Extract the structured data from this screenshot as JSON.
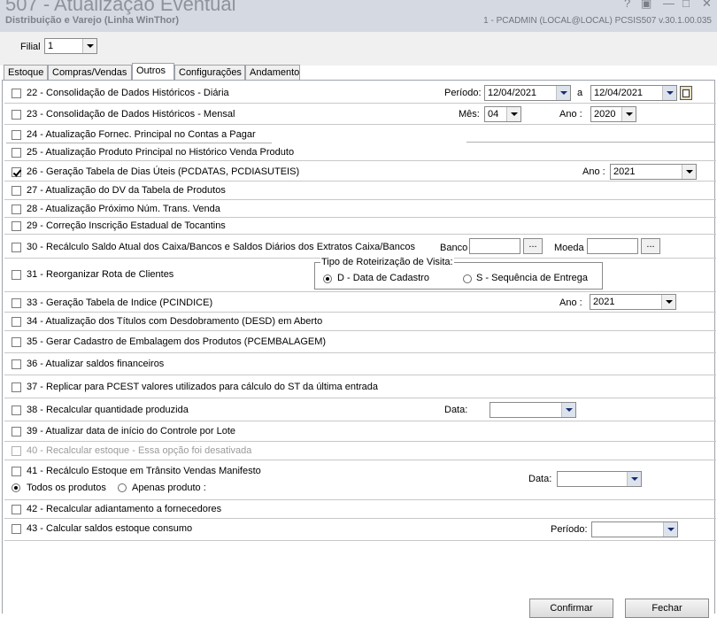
{
  "window": {
    "title": "507 - Atualização Eventual",
    "subtitle": "Distribuição e Varejo (Linha WinThor)",
    "info": "1 - PCADMIN (LOCAL@LOCAL)   PCSIS507  v.30.1.00.035",
    "controls": [
      "?",
      "▣",
      "—",
      "□",
      "✕"
    ]
  },
  "filial": {
    "label": "Filial",
    "value": "1"
  },
  "tabs": [
    {
      "label": "Estoque",
      "active": false
    },
    {
      "label": "Compras/Vendas",
      "active": false
    },
    {
      "label": "Outros",
      "active": true
    },
    {
      "label": "Configurações",
      "active": false
    },
    {
      "label": "Andamento",
      "active": false
    }
  ],
  "items": {
    "i22": {
      "label": "22 - Consolidação de Dados Históricos - Diária",
      "checked": false
    },
    "i23": {
      "label": "23 - Consolidação de Dados Históricos - Mensal",
      "checked": false
    },
    "i24": {
      "label": "24 - Atualização Fornec. Principal no Contas a Pagar",
      "checked": false
    },
    "i25": {
      "label": "25 - Atualização Produto Principal no Histórico Venda Produto",
      "checked": false
    },
    "i26": {
      "label": "26 - Geração Tabela de Dias Úteis (PCDATAS, PCDIASUTEIS)",
      "checked": true
    },
    "i27": {
      "label": "27 - Atualização do DV da Tabela de Produtos",
      "checked": false
    },
    "i28": {
      "label": "28 - Atualização Próximo Núm. Trans. Venda",
      "checked": false
    },
    "i29": {
      "label": "29 - Correção Inscrição Estadual de Tocantins",
      "checked": false
    },
    "i30": {
      "label": "30 - Recálculo Saldo Atual dos Caixa/Bancos e Saldos Diários dos Extratos Caixa/Bancos",
      "checked": false
    },
    "i31": {
      "label": "31 - Reorganizar Rota de Clientes",
      "checked": false
    },
    "i33": {
      "label": "33 - Geração Tabela de Indice (PCINDICE)",
      "checked": false
    },
    "i34": {
      "label": "34 - Atualização dos Títulos com Desdobramento (DESD) em Aberto",
      "checked": false
    },
    "i35": {
      "label": "35 - Gerar Cadastro de Embalagem dos Produtos (PCEMBALAGEM)",
      "checked": false
    },
    "i36": {
      "label": "36 - Atualizar saldos financeiros",
      "checked": false
    },
    "i37": {
      "label": "37 - Replicar para PCEST valores utilizados para cálculo do ST da última entrada",
      "checked": false
    },
    "i38": {
      "label": "38 - Recalcular quantidade produzida",
      "checked": false
    },
    "i39": {
      "label": "39 - Atualizar data de início do Controle por Lote",
      "checked": false
    },
    "i40": {
      "label": "40 - Recalcular estoque - Essa opção foi desativada",
      "checked": false
    },
    "i41": {
      "label": "41 - Recálculo Estoque em Trânsito Vendas Manifesto",
      "checked": false
    },
    "i42": {
      "label": "42 - Recalcular adiantamento a fornecedores",
      "checked": false
    },
    "i43": {
      "label": "43 - Calcular saldos estoque consumo",
      "checked": false
    }
  },
  "fields": {
    "periodo_label": "Período:",
    "periodo_from": "12/04/2021",
    "periodo_sep": "a",
    "periodo_to": "12/04/2021",
    "mes_label": "Mês:",
    "mes_value": "04",
    "ano23_label": "Ano :",
    "ano23_value": "2020",
    "ano26_label": "Ano :",
    "ano26_value": "2021",
    "banco_label": "Banco",
    "banco_value": "",
    "moeda_label": "Moeda",
    "moeda_value": "",
    "ellipsis": "...",
    "rot_group_label": "Tipo de Roteirização de Visita:",
    "rot_opt1": "D - Data de Cadastro",
    "rot_opt2": "S - Sequência de Entrega",
    "ano33_label": "Ano :",
    "ano33_value": "2021",
    "data38_label": "Data:",
    "data38_value": "",
    "opt41_all": "Todos os produtos",
    "opt41_one": "Apenas produto :",
    "data41_label": "Data:",
    "data41_value": "",
    "periodo43_label": "Período:",
    "periodo43_value": ""
  },
  "buttons": {
    "confirm": "Confirmar",
    "close": "Fechar"
  }
}
